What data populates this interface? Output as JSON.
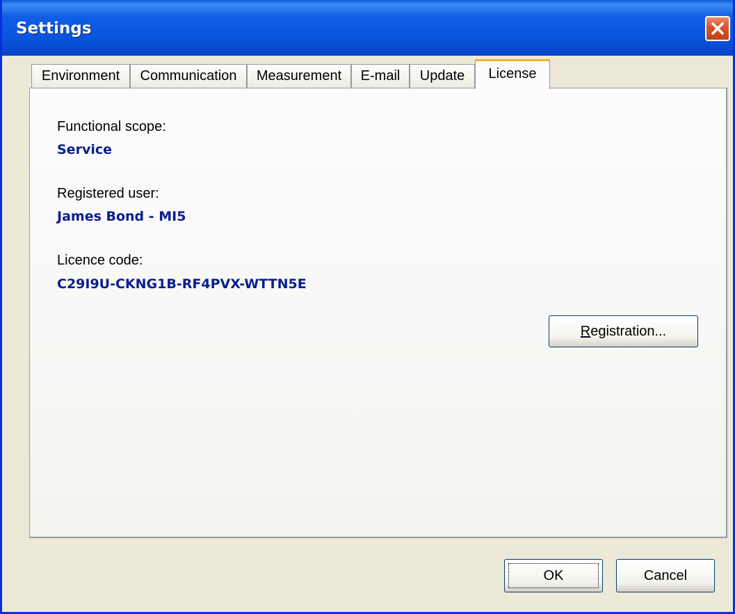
{
  "window": {
    "title": "Settings",
    "close_icon": "close-icon"
  },
  "tabs": [
    {
      "label": "Environment",
      "active": false
    },
    {
      "label": "Communication",
      "active": false
    },
    {
      "label": "Measurement",
      "active": false
    },
    {
      "label": "E-mail",
      "active": false
    },
    {
      "label": "Update",
      "active": false
    },
    {
      "label": "License",
      "active": true
    }
  ],
  "license": {
    "functional_scope_label": "Functional scope:",
    "functional_scope_value": "Service",
    "registered_user_label": "Registered user:",
    "registered_user_value": "James Bond - MI5",
    "licence_code_label": "Licence code:",
    "licence_code_value": "C29I9U-CKNG1B-RF4PVX-WTTN5E",
    "registration_button": {
      "accel": "R",
      "rest": "egistration..."
    }
  },
  "footer": {
    "ok_label": "OK",
    "cancel_label": "Cancel"
  },
  "colors": {
    "titlebar": "#0855dd",
    "value_text": "#0a1e8c",
    "dialog_bg": "#ece9d8",
    "active_tab_accent": "#f1b22b"
  }
}
